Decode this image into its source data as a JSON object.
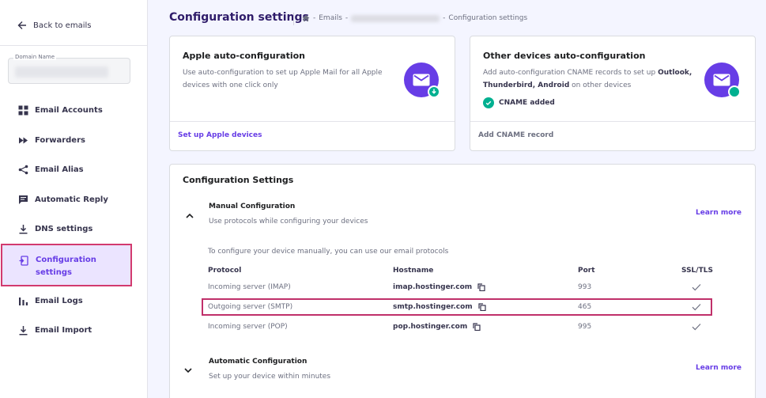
{
  "sidebar": {
    "back_label": "Back to emails",
    "domain_legend": "Domain Name",
    "items": [
      {
        "label": "Email Accounts",
        "icon": "grid-icon"
      },
      {
        "label": "Forwarders",
        "icon": "fast-forward-icon"
      },
      {
        "label": "Email Alias",
        "icon": "share-icon"
      },
      {
        "label": "Automatic Reply",
        "icon": "message-icon"
      },
      {
        "label": "DNS settings",
        "icon": "download-icon"
      },
      {
        "label": "Configuration settings",
        "icon": "config-icon",
        "active": true
      },
      {
        "label": "Email Logs",
        "icon": "bar-chart-icon"
      },
      {
        "label": "Email Import",
        "icon": "import-icon"
      }
    ]
  },
  "header": {
    "title": "Configuration settings",
    "breadcrumb": {
      "sep": "-",
      "emails": "Emails",
      "current": "Configuration settings"
    }
  },
  "apple_card": {
    "title": "Apple auto-configuration",
    "description": "Use auto-configuration to set up Apple Mail for all Apple devices with one click only",
    "link": "Set up Apple devices"
  },
  "other_card": {
    "title": "Other devices auto-configuration",
    "description_pre": "Add auto-configuration CNAME records to set up",
    "description_devices": "Outlook, Thunderbird, Android",
    "description_post": "on other devices",
    "status": "CNAME added",
    "link": "Add CNAME record"
  },
  "config": {
    "title": "Configuration Settings",
    "manual": {
      "title": "Manual Configuration",
      "subtitle": "Use protocols while configuring your devices",
      "learn_more": "Learn more",
      "intro": "To configure your device manually, you can use our email protocols"
    },
    "table": {
      "headers": {
        "protocol": "Protocol",
        "hostname": "Hostname",
        "port": "Port",
        "ssl": "SSL/TLS"
      },
      "rows": [
        {
          "protocol": "Incoming server (IMAP)",
          "hostname": "imap.hostinger.com",
          "port": "993"
        },
        {
          "protocol": "Outgoing server (SMTP)",
          "hostname": "smtp.hostinger.com",
          "port": "465"
        },
        {
          "protocol": "Incoming server (POP)",
          "hostname": "pop.hostinger.com",
          "port": "995"
        }
      ]
    },
    "automatic": {
      "title": "Automatic Configuration",
      "subtitle": "Set up your device within minutes",
      "learn_more": "Learn more"
    }
  },
  "colors": {
    "accent": "#673de6",
    "success": "#00b090",
    "highlight_border": "#c0306a"
  }
}
